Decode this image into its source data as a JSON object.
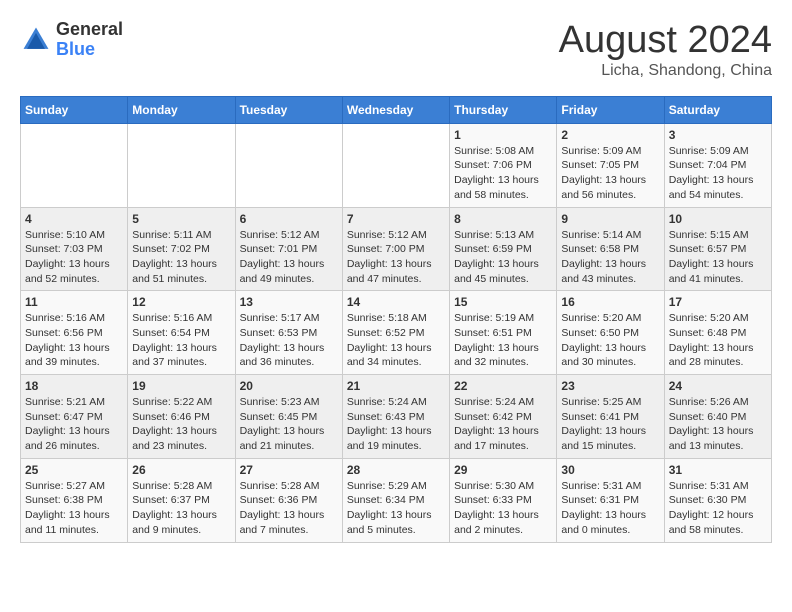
{
  "header": {
    "logo": {
      "general": "General",
      "blue": "Blue"
    },
    "title": "August 2024",
    "subtitle": "Licha, Shandong, China"
  },
  "days_of_week": [
    "Sunday",
    "Monday",
    "Tuesday",
    "Wednesday",
    "Thursday",
    "Friday",
    "Saturday"
  ],
  "weeks": [
    [
      {
        "day": "",
        "info": ""
      },
      {
        "day": "",
        "info": ""
      },
      {
        "day": "",
        "info": ""
      },
      {
        "day": "",
        "info": ""
      },
      {
        "day": "1",
        "info": "Sunrise: 5:08 AM\nSunset: 7:06 PM\nDaylight: 13 hours and 58 minutes."
      },
      {
        "day": "2",
        "info": "Sunrise: 5:09 AM\nSunset: 7:05 PM\nDaylight: 13 hours and 56 minutes."
      },
      {
        "day": "3",
        "info": "Sunrise: 5:09 AM\nSunset: 7:04 PM\nDaylight: 13 hours and 54 minutes."
      }
    ],
    [
      {
        "day": "4",
        "info": "Sunrise: 5:10 AM\nSunset: 7:03 PM\nDaylight: 13 hours and 52 minutes."
      },
      {
        "day": "5",
        "info": "Sunrise: 5:11 AM\nSunset: 7:02 PM\nDaylight: 13 hours and 51 minutes."
      },
      {
        "day": "6",
        "info": "Sunrise: 5:12 AM\nSunset: 7:01 PM\nDaylight: 13 hours and 49 minutes."
      },
      {
        "day": "7",
        "info": "Sunrise: 5:12 AM\nSunset: 7:00 PM\nDaylight: 13 hours and 47 minutes."
      },
      {
        "day": "8",
        "info": "Sunrise: 5:13 AM\nSunset: 6:59 PM\nDaylight: 13 hours and 45 minutes."
      },
      {
        "day": "9",
        "info": "Sunrise: 5:14 AM\nSunset: 6:58 PM\nDaylight: 13 hours and 43 minutes."
      },
      {
        "day": "10",
        "info": "Sunrise: 5:15 AM\nSunset: 6:57 PM\nDaylight: 13 hours and 41 minutes."
      }
    ],
    [
      {
        "day": "11",
        "info": "Sunrise: 5:16 AM\nSunset: 6:56 PM\nDaylight: 13 hours and 39 minutes."
      },
      {
        "day": "12",
        "info": "Sunrise: 5:16 AM\nSunset: 6:54 PM\nDaylight: 13 hours and 37 minutes."
      },
      {
        "day": "13",
        "info": "Sunrise: 5:17 AM\nSunset: 6:53 PM\nDaylight: 13 hours and 36 minutes."
      },
      {
        "day": "14",
        "info": "Sunrise: 5:18 AM\nSunset: 6:52 PM\nDaylight: 13 hours and 34 minutes."
      },
      {
        "day": "15",
        "info": "Sunrise: 5:19 AM\nSunset: 6:51 PM\nDaylight: 13 hours and 32 minutes."
      },
      {
        "day": "16",
        "info": "Sunrise: 5:20 AM\nSunset: 6:50 PM\nDaylight: 13 hours and 30 minutes."
      },
      {
        "day": "17",
        "info": "Sunrise: 5:20 AM\nSunset: 6:48 PM\nDaylight: 13 hours and 28 minutes."
      }
    ],
    [
      {
        "day": "18",
        "info": "Sunrise: 5:21 AM\nSunset: 6:47 PM\nDaylight: 13 hours and 26 minutes."
      },
      {
        "day": "19",
        "info": "Sunrise: 5:22 AM\nSunset: 6:46 PM\nDaylight: 13 hours and 23 minutes."
      },
      {
        "day": "20",
        "info": "Sunrise: 5:23 AM\nSunset: 6:45 PM\nDaylight: 13 hours and 21 minutes."
      },
      {
        "day": "21",
        "info": "Sunrise: 5:24 AM\nSunset: 6:43 PM\nDaylight: 13 hours and 19 minutes."
      },
      {
        "day": "22",
        "info": "Sunrise: 5:24 AM\nSunset: 6:42 PM\nDaylight: 13 hours and 17 minutes."
      },
      {
        "day": "23",
        "info": "Sunrise: 5:25 AM\nSunset: 6:41 PM\nDaylight: 13 hours and 15 minutes."
      },
      {
        "day": "24",
        "info": "Sunrise: 5:26 AM\nSunset: 6:40 PM\nDaylight: 13 hours and 13 minutes."
      }
    ],
    [
      {
        "day": "25",
        "info": "Sunrise: 5:27 AM\nSunset: 6:38 PM\nDaylight: 13 hours and 11 minutes."
      },
      {
        "day": "26",
        "info": "Sunrise: 5:28 AM\nSunset: 6:37 PM\nDaylight: 13 hours and 9 minutes."
      },
      {
        "day": "27",
        "info": "Sunrise: 5:28 AM\nSunset: 6:36 PM\nDaylight: 13 hours and 7 minutes."
      },
      {
        "day": "28",
        "info": "Sunrise: 5:29 AM\nSunset: 6:34 PM\nDaylight: 13 hours and 5 minutes."
      },
      {
        "day": "29",
        "info": "Sunrise: 5:30 AM\nSunset: 6:33 PM\nDaylight: 13 hours and 2 minutes."
      },
      {
        "day": "30",
        "info": "Sunrise: 5:31 AM\nSunset: 6:31 PM\nDaylight: 13 hours and 0 minutes."
      },
      {
        "day": "31",
        "info": "Sunrise: 5:31 AM\nSunset: 6:30 PM\nDaylight: 12 hours and 58 minutes."
      }
    ]
  ]
}
